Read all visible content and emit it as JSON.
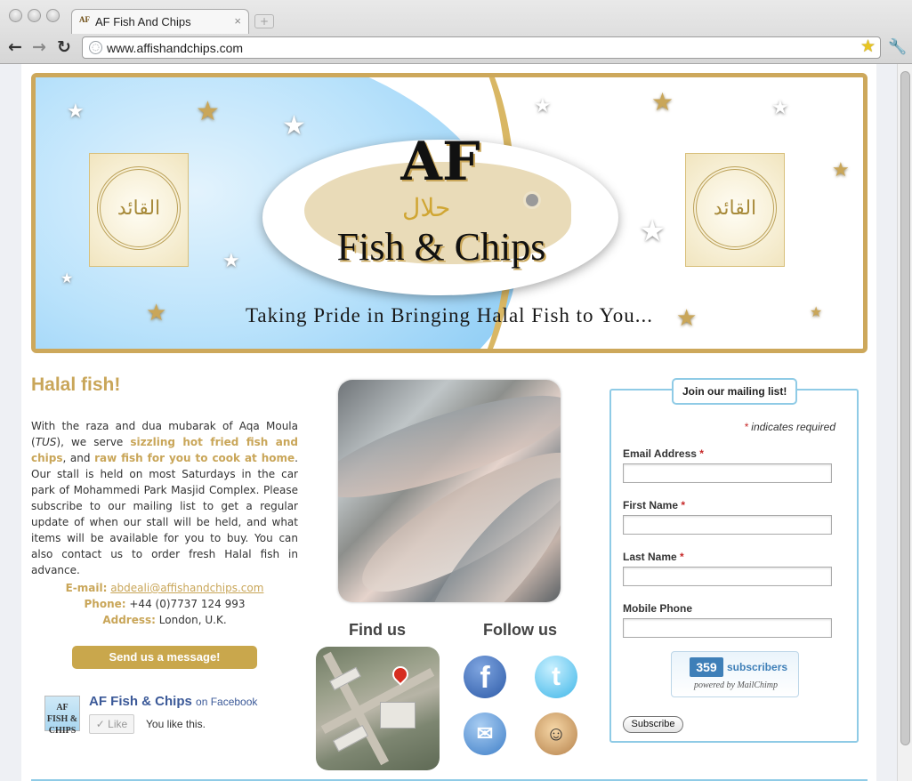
{
  "browser": {
    "tab_title": "AF Fish And Chips",
    "tab_favicon": "AF",
    "tab_close": "×",
    "new_tab": "+",
    "back": "←",
    "forward": "→",
    "reload": "↻",
    "url": "www.affishandchips.com",
    "bookmark": "★",
    "wrench": "🔧",
    "icons": [
      "back-arrow-icon",
      "forward-arrow-icon",
      "reload-icon",
      "globe-icon",
      "bookmark-star-icon",
      "wrench-icon"
    ]
  },
  "banner": {
    "logo_top": "AF",
    "logo_halal": "حلال",
    "logo_bottom": "Fish & Chips",
    "tagline": "Taking Pride in Bringing Halal Fish to You...",
    "emblem_text": "القائد"
  },
  "left": {
    "heading": "Halal fish!",
    "intro": {
      "p1": "With the raza and dua mubarak of Aqa Moula (",
      "tus": "TUS",
      "p2": "), we serve ",
      "hl1": "sizzling hot fried fish and chips",
      "p3": ", and ",
      "hl2": "raw fish for you to cook at home",
      "p4": ". Our stall is held on most Saturdays in the car park of Mohammedi Park Masjid Complex. Please subscribe to our mailing list to get a regular update of when our stall will be held, and what items will be available for you to buy. You can also contact us to order fresh Halal fish in advance."
    },
    "contact": {
      "email_label": "E-mail:",
      "email": "abdeali@affishandchips.com",
      "phone_label": "Phone:",
      "phone": "+44 (0)7737 124 993",
      "address_label": "Address:",
      "address": "London, U.K."
    },
    "message_button": "Send us a message!",
    "facebook": {
      "thumb": "AF FISH & CHIPS",
      "name": "AF Fish & Chips",
      "on_facebook": "on Facebook",
      "like_label": "✓ Like",
      "you_like": "You like this."
    }
  },
  "middle": {
    "find_us": "Find us",
    "follow_us": "Follow us",
    "social": [
      {
        "name": "facebook-icon",
        "glyph": "f"
      },
      {
        "name": "twitter-icon",
        "glyph": "t"
      },
      {
        "name": "email-icon",
        "glyph": "✉"
      },
      {
        "name": "mailchimp-icon",
        "glyph": "☺"
      }
    ]
  },
  "signup": {
    "legend": "Join our mailing list!",
    "required_star": "*",
    "required_note": " indicates required",
    "fields": [
      {
        "label": "Email Address",
        "required": "*",
        "value": ""
      },
      {
        "label": "First Name",
        "required": "*",
        "value": ""
      },
      {
        "label": "Last Name",
        "required": "*",
        "value": ""
      },
      {
        "label": "Mobile Phone",
        "required": "",
        "value": ""
      }
    ],
    "subscriber_count": "359",
    "subscribers_label": "subscribers",
    "powered_by": "powered by MailChimp",
    "subscribe_button": "Subscribe"
  },
  "colors": {
    "gold": "#c9a659",
    "frame_blue": "#8fcbe6",
    "facebook_blue": "#3b5998"
  }
}
